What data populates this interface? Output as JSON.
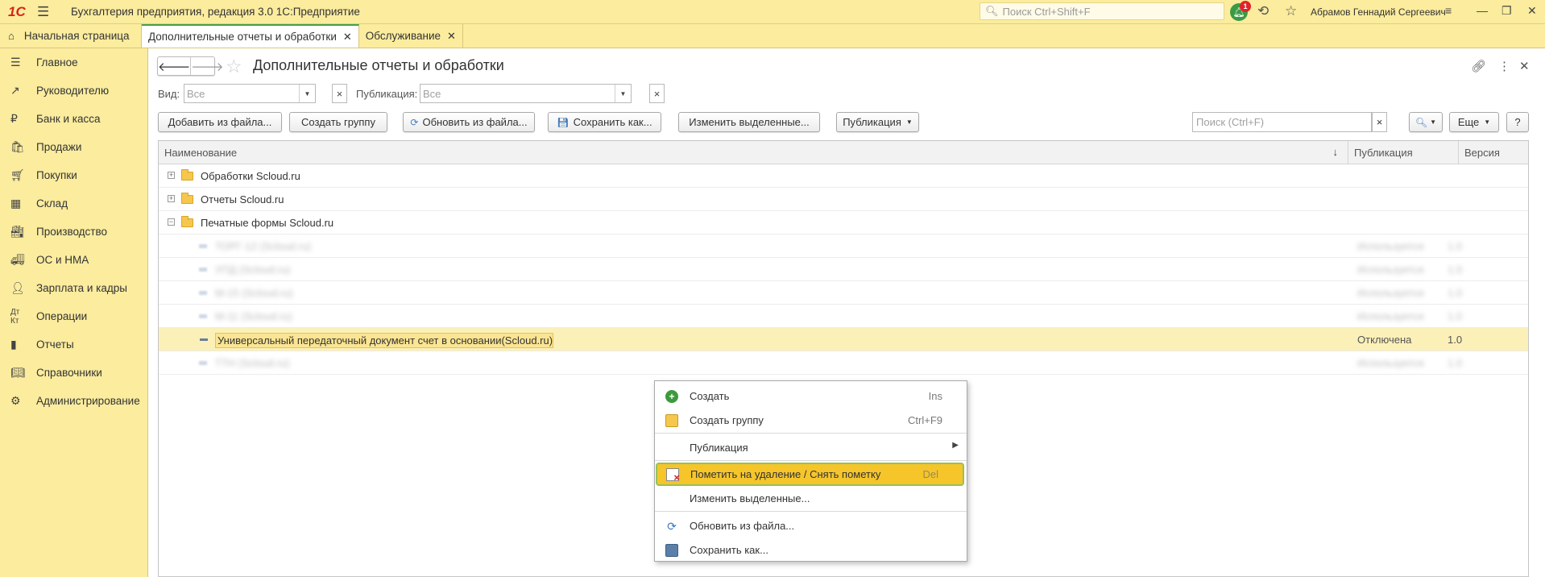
{
  "titlebar": {
    "logo": "1С",
    "app_title": "Бухгалтерия предприятия, редакция 3.0 1С:Предприятие",
    "search_placeholder": "Поиск Ctrl+Shift+F",
    "notifications_count": "1",
    "user_name": "Абрамов Геннадий Сергеевич"
  },
  "tabs": {
    "home": "Начальная страница",
    "active": "Дополнительные отчеты и обработки",
    "service": "Обслуживание"
  },
  "sidebar": {
    "items": [
      {
        "label": "Главное",
        "icon": "menu-icon"
      },
      {
        "label": "Руководителю",
        "icon": "trend-icon"
      },
      {
        "label": "Банк и касса",
        "icon": "ruble-icon"
      },
      {
        "label": "Продажи",
        "icon": "bag-icon"
      },
      {
        "label": "Покупки",
        "icon": "cart-icon"
      },
      {
        "label": "Склад",
        "icon": "warehouse-icon"
      },
      {
        "label": "Производство",
        "icon": "factory-icon"
      },
      {
        "label": "ОС и НМА",
        "icon": "truck-icon"
      },
      {
        "label": "Зарплата и кадры",
        "icon": "person-icon"
      },
      {
        "label": "Операции",
        "icon": "dt-kt-icon"
      },
      {
        "label": "Отчеты",
        "icon": "bar-chart-icon"
      },
      {
        "label": "Справочники",
        "icon": "book-icon"
      },
      {
        "label": "Администрирование",
        "icon": "gear-icon"
      }
    ]
  },
  "page": {
    "title": "Дополнительные отчеты и обработки",
    "filters": {
      "vid_label": "Вид:",
      "vid_value": "Все",
      "pub_label": "Публикация:",
      "pub_value": "Все"
    },
    "toolbar": {
      "add_from_file": "Добавить из файла...",
      "create_group": "Создать группу",
      "update_from_file": "Обновить из файла...",
      "save_as": "Сохранить как...",
      "change_selected": "Изменить выделенные...",
      "publication": "Публикация",
      "search_placeholder": "Поиск (Ctrl+F)",
      "more": "Еще",
      "help": "?"
    },
    "table": {
      "columns": [
        "Наименование",
        "Публикация",
        "Версия"
      ],
      "groups": [
        {
          "name": "Обработки Scloud.ru",
          "expanded": false
        },
        {
          "name": "Отчеты Scloud.ru",
          "expanded": false
        },
        {
          "name": "Печатные формы Scloud.ru",
          "expanded": true
        }
      ],
      "blurred_rows": [
        {
          "name": "ТОРГ-12 (Scloud.ru)",
          "publication": "Используется",
          "version": "1.0"
        },
        {
          "name": "УПД (Scloud.ru)",
          "publication": "Используется",
          "version": "1.0"
        },
        {
          "name": "М-15 (Scloud.ru)",
          "publication": "Используется",
          "version": "1.0"
        },
        {
          "name": "М-11 (Scloud.ru)",
          "publication": "Используется",
          "version": "1.0"
        }
      ],
      "selected_row": {
        "name": "Универсальный передаточный документ счет в основании(Scloud.ru)",
        "publication": "Отключена",
        "version": "1.0"
      },
      "last_row": {
        "name": "ТТН (Scloud.ru)",
        "publication": "Используется",
        "version": "1.0"
      }
    }
  },
  "context_menu": {
    "create": "Создать",
    "create_shortcut": "Ins",
    "create_group": "Создать группу",
    "create_group_shortcut": "Ctrl+F9",
    "publication": "Публикация",
    "mark_delete": "Пометить на удаление / Снять пометку",
    "mark_delete_shortcut": "Del",
    "change_selected": "Изменить выделенные...",
    "update_from_file": "Обновить из файла...",
    "save_as": "Сохранить как..."
  },
  "colors": {
    "sidebar_bg": "#fbec9e",
    "highlight": "#f5c52a",
    "selected_row": "#fbf0b8",
    "accent_green": "#45a049"
  }
}
